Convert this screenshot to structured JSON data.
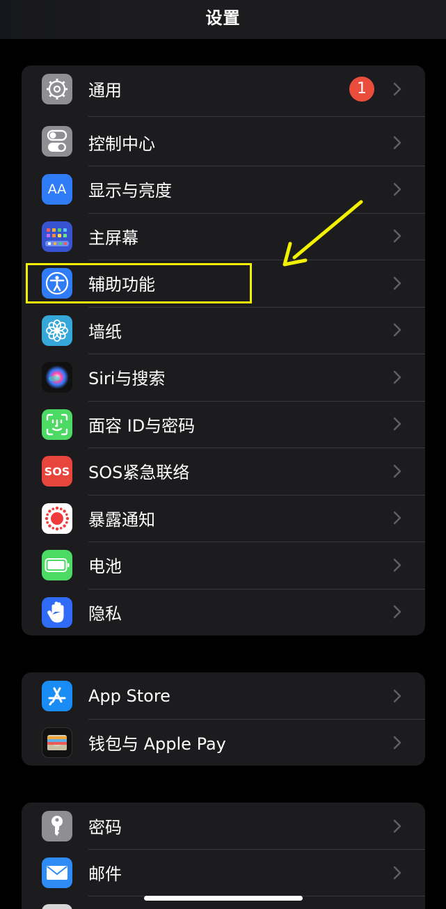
{
  "nav": {
    "title": "设置"
  },
  "group1": [
    {
      "label": "通用",
      "icon": "gear-icon",
      "badge": "1"
    },
    {
      "label": "控制中心",
      "icon": "toggles-icon"
    },
    {
      "label": "显示与亮度",
      "icon": "display-aa-icon",
      "icon_text": "AA"
    },
    {
      "label": "主屏幕",
      "icon": "home-screen-grid-icon"
    },
    {
      "label": "辅助功能",
      "icon": "accessibility-icon",
      "highlighted": true
    },
    {
      "label": "墙纸",
      "icon": "wallpaper-flower-icon"
    },
    {
      "label": "Siri与搜索",
      "icon": "siri-orb-icon"
    },
    {
      "label": "面容 ID与密码",
      "icon": "face-id-icon"
    },
    {
      "label": "SOS紧急联络",
      "icon": "sos-icon",
      "icon_text": "SOS"
    },
    {
      "label": "暴露通知",
      "icon": "exposure-notification-icon"
    },
    {
      "label": "电池",
      "icon": "battery-icon"
    },
    {
      "label": "隐私",
      "icon": "hand-privacy-icon"
    }
  ],
  "group2": [
    {
      "label": "App Store",
      "icon": "app-store-icon"
    },
    {
      "label": "钱包与 Apple Pay",
      "icon": "wallet-icon"
    }
  ],
  "group3": [
    {
      "label": "密码",
      "icon": "key-icon"
    },
    {
      "label": "邮件",
      "icon": "mail-envelope-icon"
    }
  ],
  "colors": {
    "background": "#000000",
    "group_bg": "#1c1c1e",
    "badge_red": "#eb4d3d",
    "highlight_yellow": "#f2f200",
    "chevron": "#5f5f63"
  }
}
